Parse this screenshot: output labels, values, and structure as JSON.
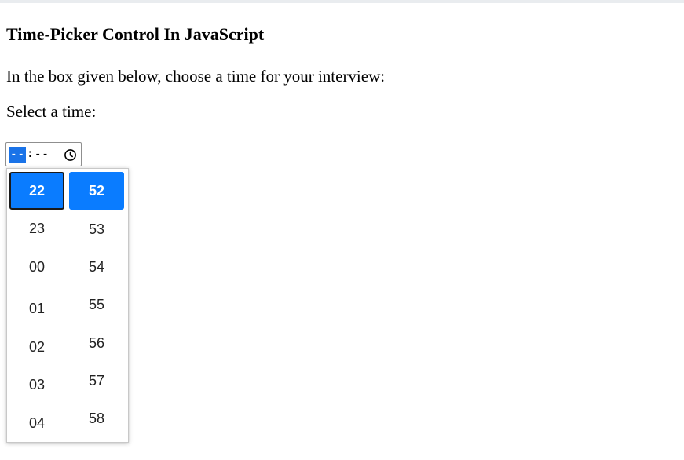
{
  "page": {
    "title": "Time-Picker Control In JavaScript",
    "intro": "In the box given below, choose a time for your interview:",
    "select_label": "Select a time:"
  },
  "time_input": {
    "hour_placeholder": "--",
    "separator": ":",
    "minute_placeholder": "--",
    "icon": "clock-icon"
  },
  "picker": {
    "hours": [
      "22",
      "23",
      "00",
      "01",
      "02",
      "03",
      "04"
    ],
    "minutes": [
      "52",
      "53",
      "54",
      "55",
      "56",
      "57",
      "58"
    ],
    "selected_hour": "22",
    "selected_minute": "52"
  },
  "colors": {
    "accent": "#0a7cff",
    "segment_highlight": "#1a73e8"
  }
}
